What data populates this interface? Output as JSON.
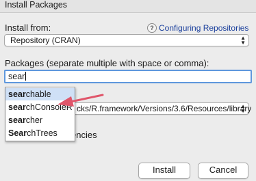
{
  "window": {
    "title": "Install Packages"
  },
  "install_from": {
    "label": "Install from:",
    "help_link": "Configuring Repositories",
    "help_icon": "?",
    "selected": "Repository (CRAN)"
  },
  "packages": {
    "label": "Packages (separate multiple with space or comma):",
    "value": "sear"
  },
  "autocomplete": [
    {
      "match": "sear",
      "rest": "chable"
    },
    {
      "match": "sear",
      "rest": "chConsoleR"
    },
    {
      "match": "sear",
      "rest": "cher"
    },
    {
      "match": "Sear",
      "rest": "chTrees"
    }
  ],
  "library": {
    "selected_visible": "cks/R.framework/Versions/3.6/Resources/library"
  },
  "dependencies": {
    "label_visible": "encies"
  },
  "buttons": {
    "install": "Install",
    "cancel": "Cancel"
  },
  "colors": {
    "focus": "#5e97dd",
    "selection": "#cfe0f6",
    "arrow": "#e0566a",
    "link": "#1a3f9c"
  }
}
